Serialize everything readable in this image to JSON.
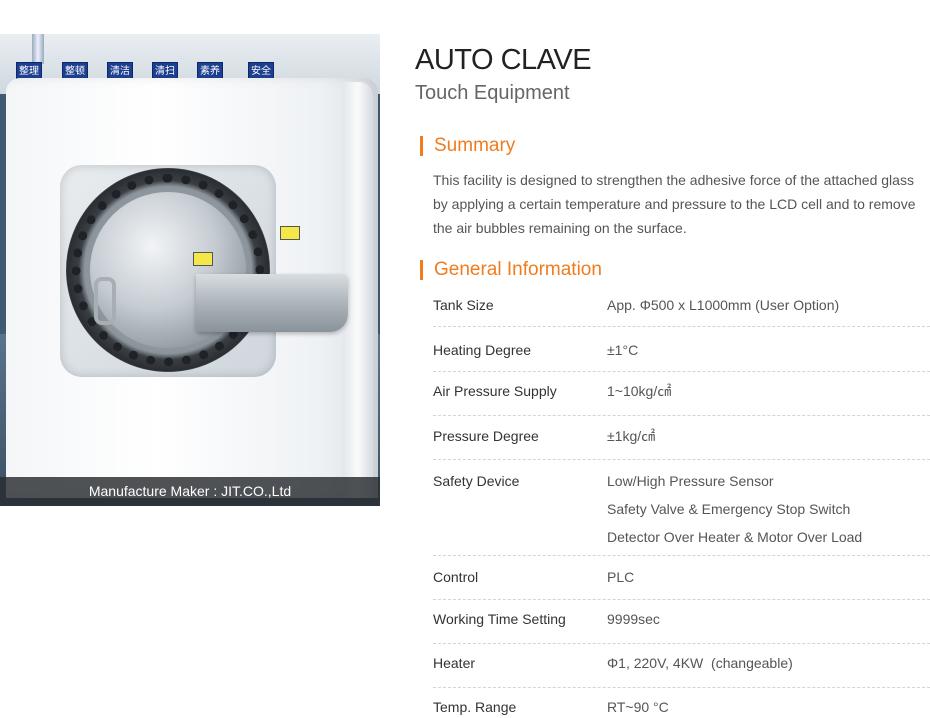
{
  "image": {
    "signs": [
      "整理",
      "整顿",
      "清洁",
      "清扫",
      "素养",
      "安全"
    ],
    "caption": "Manufacture Maker : JIT.CO.,Ltd"
  },
  "header": {
    "title": "AUTO CLAVE",
    "subtitle": "Touch Equipment"
  },
  "summary": {
    "heading": "Summary",
    "text": "This facility is designed to strengthen the adhesive force of the attached glass by applying a certain temperature and pressure to the LCD cell and to remove the air bubbles remaining on the surface."
  },
  "general": {
    "heading": "General Information",
    "rows": [
      {
        "key": "Tank Size",
        "values": [
          "App. Φ500 x L1000mm (User Option)"
        ]
      },
      {
        "key": "Heating Degree",
        "values": [
          "±1°C"
        ]
      },
      {
        "key": "Air Pressure Supply",
        "values": [
          "1~10kg/㎠"
        ]
      },
      {
        "key": "Pressure Degree",
        "values": [
          "±1kg/㎠"
        ]
      },
      {
        "key": "Safety Device",
        "values": [
          "Low/High Pressure Sensor",
          "Safety Valve & Emergency Stop Switch",
          "Detector Over Heater & Motor Over Load"
        ]
      },
      {
        "key": "Control",
        "values": [
          "PLC"
        ]
      },
      {
        "key": "Working Time Setting",
        "values": [
          "9999sec"
        ]
      },
      {
        "key": "Heater",
        "values": [
          "Φ1, 220V, 4KW  (changeable)"
        ]
      },
      {
        "key": "Temp. Range",
        "values": [
          "RT~90 °C"
        ]
      }
    ]
  },
  "colors": {
    "accent": "#f07c1e",
    "caption_bg": "#2c3034",
    "sign_bg": "#1d3f8f"
  }
}
